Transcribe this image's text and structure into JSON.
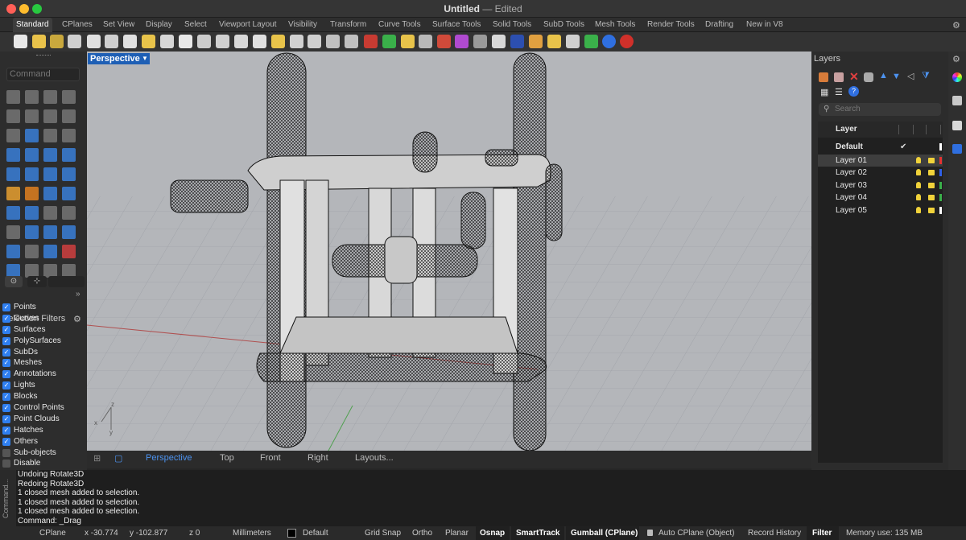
{
  "window": {
    "title": "Untitled",
    "title_suffix": "— Edited"
  },
  "tabs": [
    "Standard",
    "CPlanes",
    "Set View",
    "Display",
    "Select",
    "Viewport Layout",
    "Visibility",
    "Transform",
    "Curve Tools",
    "Surface Tools",
    "Solid Tools",
    "SubD Tools",
    "Mesh Tools",
    "Render Tools",
    "Drafting",
    "New in V8"
  ],
  "command": {
    "placeholder": "Command"
  },
  "selection_filters": {
    "title": "Selection Filters",
    "items": [
      {
        "label": "Points",
        "checked": true
      },
      {
        "label": "Curves",
        "checked": true
      },
      {
        "label": "Surfaces",
        "checked": true
      },
      {
        "label": "PolySurfaces",
        "checked": true
      },
      {
        "label": "SubDs",
        "checked": true
      },
      {
        "label": "Meshes",
        "checked": true
      },
      {
        "label": "Annotations",
        "checked": true
      },
      {
        "label": "Lights",
        "checked": true
      },
      {
        "label": "Blocks",
        "checked": true
      },
      {
        "label": "Control Points",
        "checked": true
      },
      {
        "label": "Point Clouds",
        "checked": true
      },
      {
        "label": "Hatches",
        "checked": true
      },
      {
        "label": "Others",
        "checked": true
      },
      {
        "label": "Sub-objects",
        "checked": false
      },
      {
        "label": "Disable",
        "checked": false
      }
    ]
  },
  "viewport": {
    "label": "Perspective",
    "axes": {
      "x": "x",
      "y": "y",
      "z": "z"
    }
  },
  "view_tabs": [
    "Perspective",
    "Top",
    "Front",
    "Right",
    "Layouts..."
  ],
  "layers": {
    "title": "Layers",
    "search_placeholder": "Search",
    "header": "Layer",
    "rows": [
      {
        "name": "Default",
        "current": true,
        "color": "#ffffff"
      },
      {
        "name": "Layer 01",
        "color": "#e63232"
      },
      {
        "name": "Layer 02",
        "color": "#2f5fe8"
      },
      {
        "name": "Layer 03",
        "color": "#3ab04a"
      },
      {
        "name": "Layer 04",
        "color": "#3ab04a"
      },
      {
        "name": "Layer 05",
        "color": "#ffffff"
      }
    ]
  },
  "command_history": {
    "side_label": "Command...",
    "lines": [
      "Undoing Rotate3D",
      "Redoing Rotate3D",
      "1 closed mesh added to selection.",
      "1 closed mesh added to selection.",
      "1 closed mesh added to selection.",
      "Command: _Drag"
    ]
  },
  "status": {
    "cplane": "CPlane",
    "x": "x -30.774",
    "y": "y -102.877",
    "z": "z 0",
    "units": "Millimeters",
    "layer": "Default",
    "grid_snap": "Grid Snap",
    "ortho": "Ortho",
    "planar": "Planar",
    "osnap": "Osnap",
    "smarttrack": "SmartTrack",
    "gumball": "Gumball (CPlane)",
    "autocplane": "Auto CPlane (Object)",
    "record_history": "Record History",
    "filter": "Filter",
    "memory": "Memory use: 135 MB"
  }
}
